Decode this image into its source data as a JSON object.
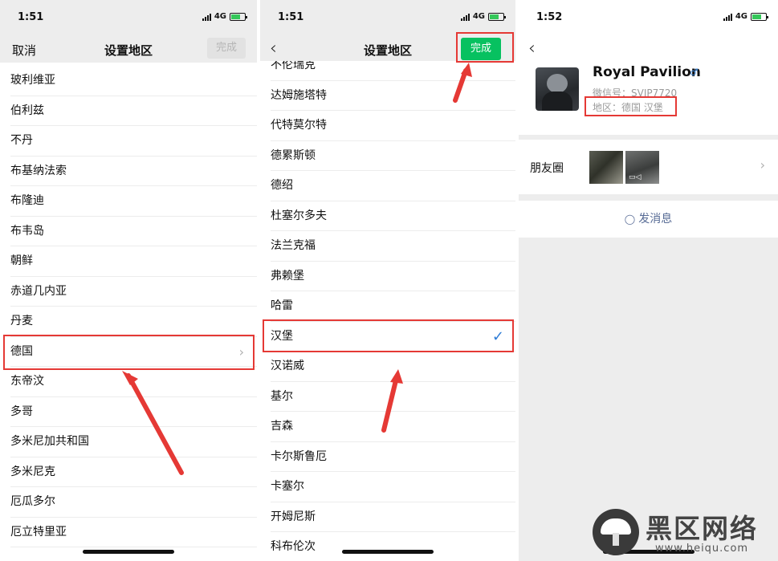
{
  "status": {
    "panel1_time": "1:51",
    "panel2_time": "1:51",
    "panel3_time": "1:52",
    "network": "4G"
  },
  "panel1": {
    "cancel_label": "取消",
    "title": "设置地区",
    "done_label": "完成",
    "items": [
      "玻利维亚",
      "伯利兹",
      "不丹",
      "布基纳法索",
      "布隆迪",
      "布韦岛",
      "朝鲜",
      "赤道几内亚",
      "丹麦",
      "德国",
      "东帝汶",
      "多哥",
      "多米尼加共和国",
      "多米尼克",
      "厄瓜多尔",
      "厄立特里亚"
    ],
    "selected": "德国"
  },
  "panel2": {
    "title": "设置地区",
    "done_label": "完成",
    "items": [
      "不伦瑞克",
      "达姆施塔特",
      "代特莫尔特",
      "德累斯顿",
      "德绍",
      "杜塞尔多夫",
      "法兰克福",
      "弗赖堡",
      "哈雷",
      "汉堡",
      "汉诺威",
      "基尔",
      "吉森",
      "卡尔斯鲁厄",
      "卡塞尔",
      "开姆尼斯",
      "科布伦次"
    ],
    "selected": "汉堡"
  },
  "panel3": {
    "name": "Royal Pavilion",
    "wechat_id": "微信号：SVIP7720",
    "region": "地区：德国 汉堡",
    "moments_label": "朋友圈",
    "send_message": "发消息"
  },
  "watermark": {
    "text": "黑区网络",
    "url": "www.heiqu.com"
  },
  "colors": {
    "highlight_box": "#e53935",
    "wechat_green": "#07c160",
    "link_blue": "#576b95",
    "check_blue": "#2e7cd6"
  }
}
